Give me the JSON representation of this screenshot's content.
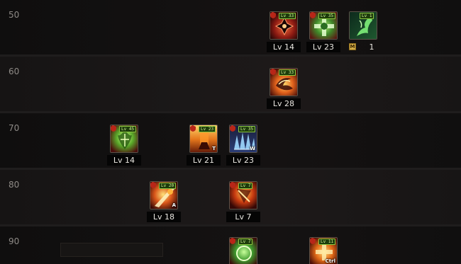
{
  "rows": [
    {
      "level": "50",
      "skills": [
        {
          "name": "cross-burst",
          "badge": "Lv 33",
          "level": "Lv 14",
          "key": "",
          "palette": "red"
        },
        {
          "name": "green-cross",
          "badge": "Lv 35",
          "level": "Lv 23",
          "key": "",
          "palette": "green"
        },
        {
          "name": "green-wind",
          "badge": "Lv 1",
          "level": "1",
          "key": "",
          "palette": "teal",
          "mastery": "M"
        }
      ]
    },
    {
      "level": "60",
      "skills": [
        {
          "name": "fire-spin",
          "badge": "Lv 33",
          "level": "Lv 28",
          "key": "",
          "palette": "orange"
        }
      ]
    },
    {
      "level": "70",
      "skills": [
        {
          "name": "green-flame",
          "badge": "Lv 45",
          "level": "Lv 14",
          "key": "",
          "palette": "green"
        },
        {
          "name": "fire-pillar",
          "badge": "Lv 23",
          "level": "Lv 21",
          "key": "T",
          "palette": "orange"
        },
        {
          "name": "blue-spikes",
          "badge": "Lv 35",
          "level": "Lv 23",
          "key": "W",
          "palette": "blue"
        }
      ]
    },
    {
      "level": "80",
      "skills": [
        {
          "name": "fire-slash",
          "badge": "Lv 20",
          "level": "Lv 18",
          "key": "A",
          "palette": "orange"
        },
        {
          "name": "fire-strike",
          "badge": "Lv 7",
          "level": "Lv 7",
          "key": "",
          "palette": "orange"
        }
      ]
    },
    {
      "level": "90",
      "skills": [
        {
          "name": "green-orb",
          "badge": "Lv 7",
          "level": "",
          "key": "",
          "palette": "green"
        },
        {
          "name": "fire-cross",
          "badge": "Lv 11",
          "level": "",
          "key": "Ctrl",
          "palette": "orange"
        }
      ]
    }
  ],
  "colors": {
    "badge_bg": "#1d3d0b",
    "badge_border": "#8cc63f",
    "label_text": "#8e8a86",
    "level_text": "#e9e6e0"
  }
}
